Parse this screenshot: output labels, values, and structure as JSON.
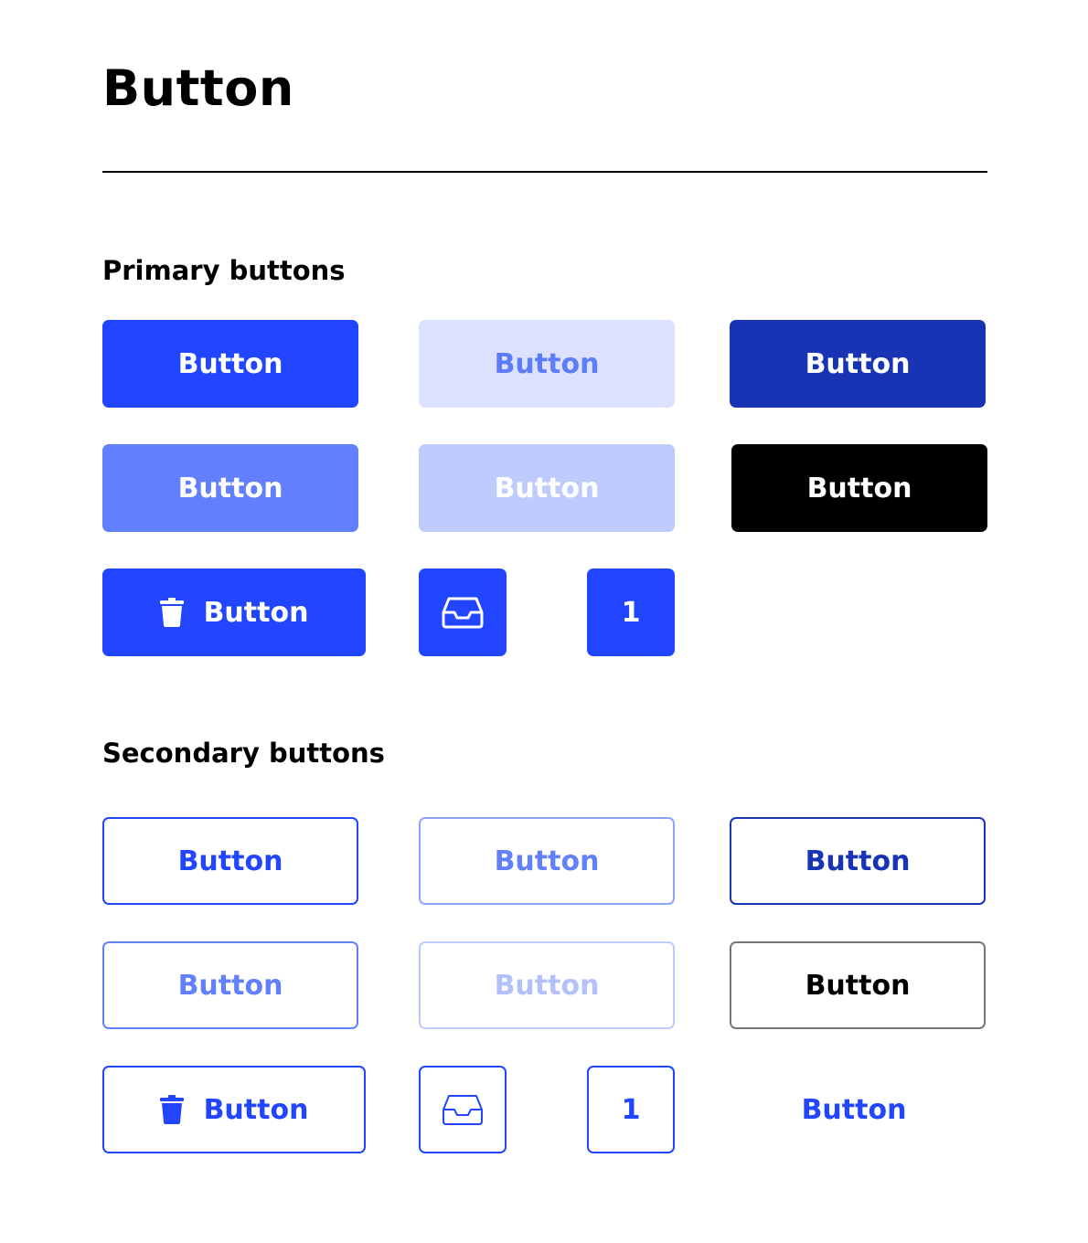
{
  "page": {
    "title": "Button"
  },
  "primary": {
    "title": "Primary buttons",
    "row1": [
      "Button",
      "Button",
      "Button"
    ],
    "row2": [
      "Button",
      "Button",
      "Button"
    ],
    "icon_button_label": "Button",
    "number_button": "1"
  },
  "secondary": {
    "title": "Secondary buttons",
    "row1": [
      "Button",
      "Button",
      "Button"
    ],
    "row2": [
      "Button",
      "Button",
      "Button"
    ],
    "icon_button_label": "Button",
    "number_button": "1",
    "text_button": "Button"
  },
  "colors": {
    "primary": "#2246ff",
    "primary_dark": "#1833b4",
    "primary_light": "#627ffe",
    "primary_pale": "#c0cbfd",
    "primary_soft": "#dce2fe",
    "black": "#000000"
  },
  "icons": {
    "trash": "trash-icon",
    "inbox": "inbox-icon"
  }
}
